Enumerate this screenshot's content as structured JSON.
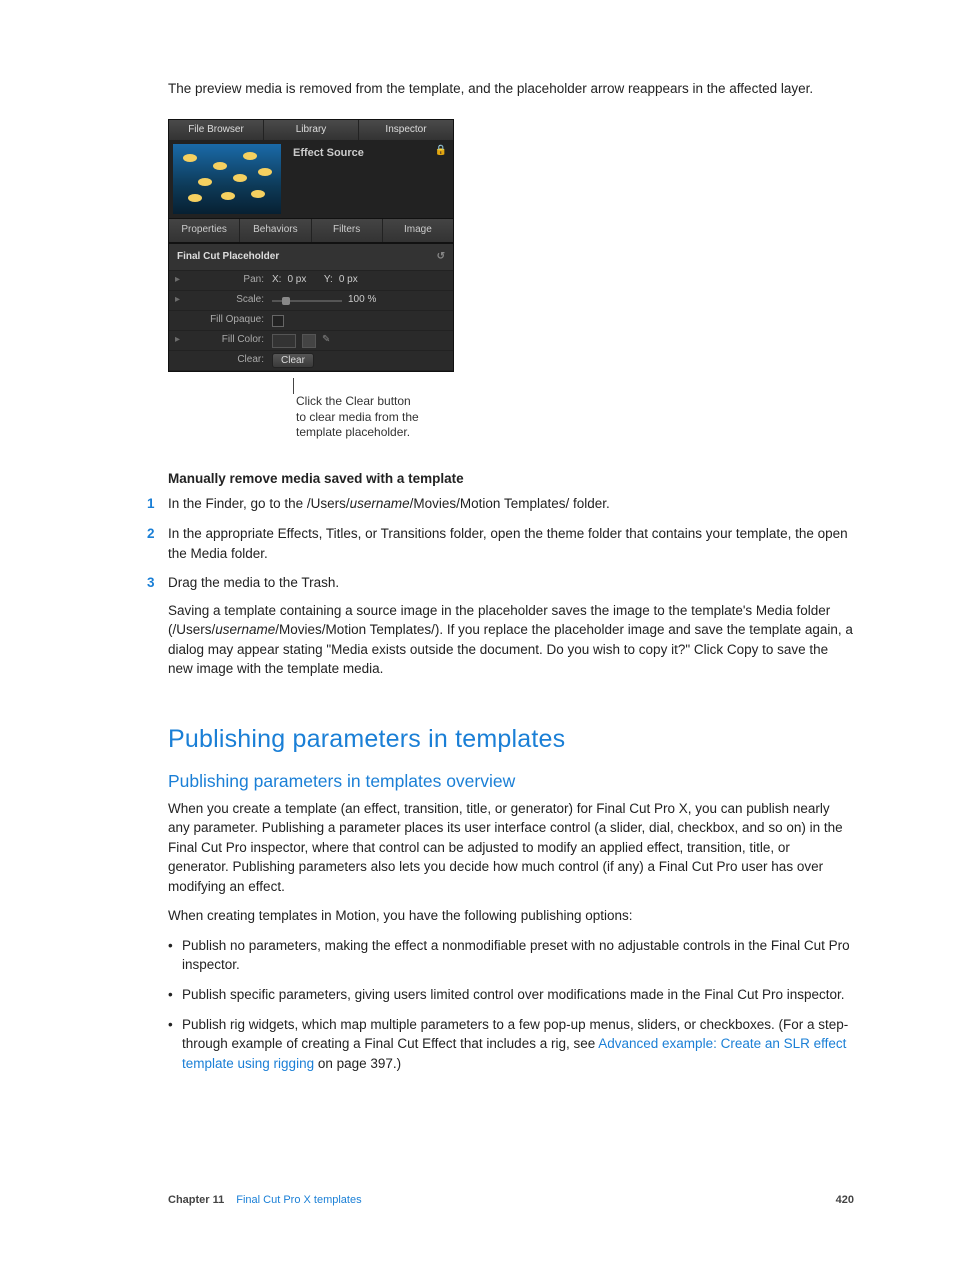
{
  "intro": "The preview media is removed from the template, and the placeholder arrow reappears in the affected layer.",
  "panel": {
    "top_tabs": [
      "File Browser",
      "Library",
      "Inspector"
    ],
    "effect_title": "Effect Source",
    "mid_tabs": [
      "Properties",
      "Behaviors",
      "Filters",
      "Image"
    ],
    "section_title": "Final Cut Placeholder",
    "params": {
      "pan_label": "Pan:",
      "pan_x_label": "X:",
      "pan_x_val": "0 px",
      "pan_y_label": "Y:",
      "pan_y_val": "0 px",
      "scale_label": "Scale:",
      "scale_val": "100 %",
      "fill_opaque_label": "Fill Opaque:",
      "fill_color_label": "Fill Color:",
      "clear_label": "Clear:",
      "clear_button": "Clear"
    }
  },
  "callout": {
    "line1": "Click the Clear button",
    "line2": "to clear media from the",
    "line3": "template placeholder."
  },
  "manual_head": "Manually remove media saved with a template",
  "steps": {
    "s1a": "In the Finder, go to the /Users/",
    "s1b": "username",
    "s1c": "/Movies/Motion Templates/ folder.",
    "s2": "In the appropriate Effects, Titles, or Transitions folder, open the theme folder that contains your template, the open the Media folder.",
    "s3": "Drag the media to the Trash."
  },
  "note": {
    "a": "Saving a template containing a source image in the placeholder saves the image to the template's Media folder (/Users/",
    "b": "username",
    "c": "/Movies/Motion Templates/). If you replace the placeholder image and save the template again, a dialog may appear stating \"Media exists outside the document. Do you wish to copy it?\" Click Copy to save the new image with the template media."
  },
  "section_title": "Publishing parameters in templates",
  "subsection_title": "Publishing parameters in templates overview",
  "overview_p1": "When you create a template (an effect, transition, title, or generator) for Final Cut Pro X, you can publish nearly any parameter. Publishing a parameter places its user interface control (a slider, dial, checkbox, and so on) in the Final Cut Pro inspector, where that control can be adjusted to modify an applied effect, transition, title, or generator. Publishing parameters also lets you decide how much control (if any) a Final Cut Pro user has over modifying an effect.",
  "overview_p2": "When creating templates in Motion, you have the following publishing options:",
  "bullets": {
    "b1": "Publish no parameters, making the effect a nonmodifiable preset with no adjustable controls in the Final Cut Pro inspector.",
    "b2": "Publish specific parameters, giving users limited control over modifications made in the Final Cut Pro inspector.",
    "b3a": "Publish rig widgets, which map multiple parameters to a few pop-up menus, sliders, or checkboxes. (For a step-through example of creating a Final Cut Effect that includes a rig, see ",
    "b3link": "Advanced example: Create an SLR effect template using rigging",
    "b3b": " on page 397.)"
  },
  "footer": {
    "chapter": "Chapter 11",
    "title": "Final Cut Pro X templates",
    "page": "420"
  }
}
